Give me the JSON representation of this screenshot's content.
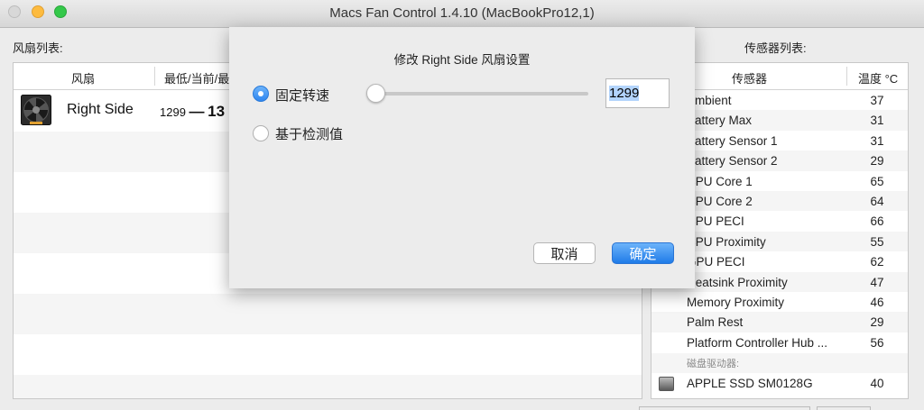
{
  "window": {
    "title": "Macs Fan Control 1.4.10 (MacBookPro12,1)"
  },
  "fans_panel": {
    "label": "风扇列表:",
    "col_fan": "风扇",
    "col_speed": "最低/当前/最",
    "rows": [
      {
        "name": "Right Side",
        "min": "1299",
        "dash": "—",
        "current": "13"
      }
    ]
  },
  "sensors_panel": {
    "label": "传感器列表:",
    "col_sensor": "传感器",
    "col_temp": "温度 °C",
    "rows": [
      {
        "name": "Ambient",
        "value": "37"
      },
      {
        "name": "Battery Max",
        "value": "31"
      },
      {
        "name": "Battery Sensor 1",
        "value": "31"
      },
      {
        "name": "Battery Sensor 2",
        "value": "29"
      },
      {
        "name": "CPU Core 1",
        "value": "65"
      },
      {
        "name": "CPU Core 2",
        "value": "64"
      },
      {
        "name": "CPU PECI",
        "value": "66"
      },
      {
        "name": "CPU Proximity",
        "value": "55"
      },
      {
        "name": "GPU PECI",
        "value": "62"
      },
      {
        "name": "Heatsink Proximity",
        "value": "47"
      },
      {
        "name": "Memory Proximity",
        "value": "46"
      },
      {
        "name": "Palm Rest",
        "value": "29"
      },
      {
        "name": "Platform Controller Hub ...",
        "value": "56"
      }
    ],
    "disk_group_label": "磁盘驱动器:",
    "disk": {
      "name": "APPLE SSD SM0128G",
      "value": "40"
    }
  },
  "dialog": {
    "title": "修改 Right Side 风扇设置",
    "option_fixed": "固定转速",
    "option_sensor": "基于检测值",
    "selected_option": "fixed",
    "speed_value": "1299",
    "slider_fraction": 0.0,
    "cancel_label": "取消",
    "ok_label": "确定"
  },
  "colors": {
    "accent": "#2f86f0",
    "close": "#d8d8d8",
    "minimize": "#fdbb3f",
    "maximize": "#34c84a"
  }
}
